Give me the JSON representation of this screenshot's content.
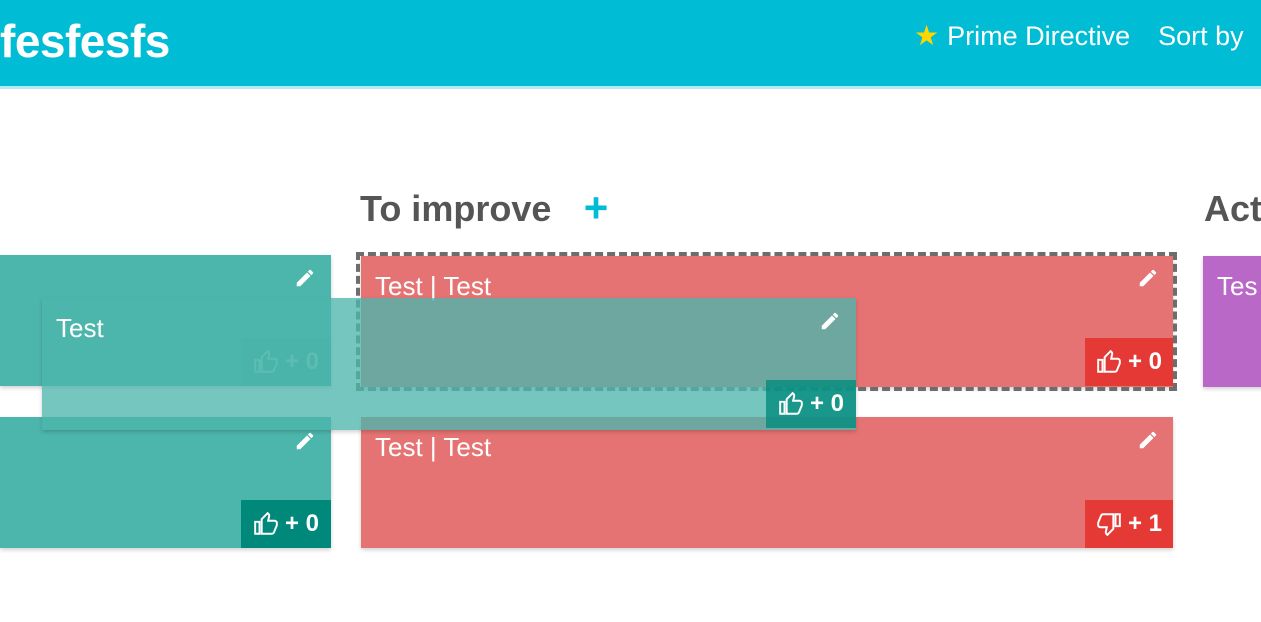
{
  "header": {
    "board_title": "fesfesfs",
    "prime_directive_label": "Prime Directive",
    "sort_label": "Sort by"
  },
  "columns": {
    "to_improve_title": "To improve",
    "add_label": "+",
    "actions_title_partial": "Act"
  },
  "cards": {
    "left_top": {
      "vote": "+ 0"
    },
    "left_bottom": {
      "vote": "+ 0"
    },
    "improve_top": {
      "text": "Test | Test",
      "vote": "+ 0"
    },
    "improve_bottom": {
      "text": "Test | Test",
      "vote": "+ 1"
    },
    "actions_top": {
      "text": "Tes"
    },
    "dragging": {
      "text": "Test",
      "vote": "+ 0"
    }
  },
  "colors": {
    "header": "#00bcd4",
    "good_card": "#4db6ac",
    "improve_card": "#e57373",
    "action_card": "#ba68c8",
    "star": "#ffd600"
  }
}
